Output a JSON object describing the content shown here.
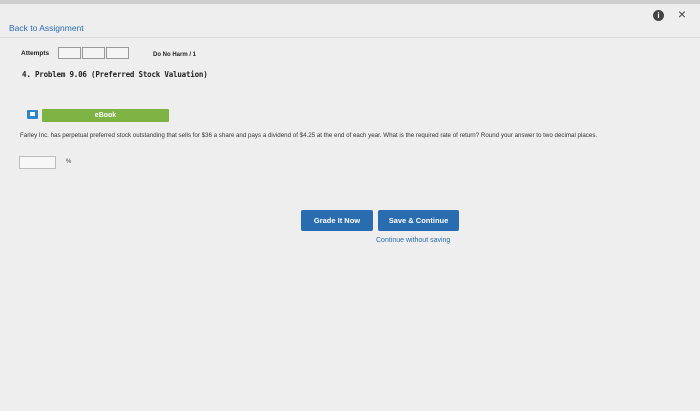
{
  "header": {
    "back_link": "Back to Assignment",
    "help_icon": "i",
    "close_icon": "×"
  },
  "attempts": {
    "label": "Attempts",
    "boxes": [
      "",
      "",
      ""
    ],
    "do_no_harm": "Do No Harm / 1"
  },
  "problem": {
    "title": "4.  Problem 9.06 (Preferred Stock Valuation)",
    "ebook_label": "eBook",
    "question": "Farley Inc. has perpetual preferred stock outstanding that sells for $36 a share and pays a dividend of $4.25 at the end of each year. What is the required rate of return? Round your answer to two decimal places.",
    "answer_value": "",
    "unit": "%"
  },
  "actions": {
    "grade_now": "Grade It Now",
    "save_continue": "Save & Continue",
    "continue_without_saving": "Continue without saving"
  },
  "colors": {
    "accent_blue": "#2a6cb0",
    "ebook_green": "#7cb342",
    "background": "#eeeeee"
  }
}
